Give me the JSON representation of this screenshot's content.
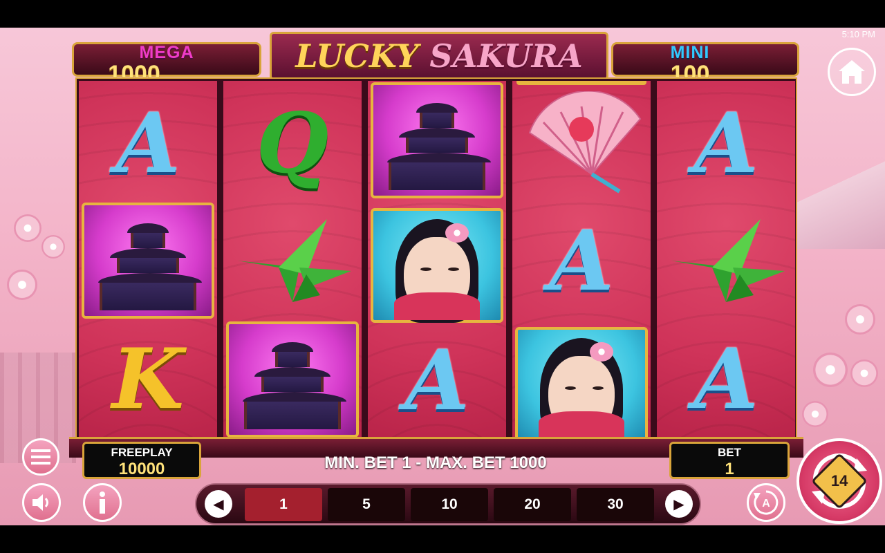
{
  "status": {
    "time": "5:10 PM"
  },
  "jackpots": {
    "mega": {
      "label": "MEGA",
      "value": "1000"
    },
    "mini": {
      "label": "MINI",
      "value": "100"
    }
  },
  "title": {
    "word1": "LUCKY",
    "word2": "SAKURA"
  },
  "reels": [
    [
      "A",
      "pagoda",
      "K"
    ],
    [
      "Q",
      "crane",
      "pagoda"
    ],
    [
      "pagoda",
      "geisha",
      "A"
    ],
    [
      "fan",
      "A",
      "geisha"
    ],
    [
      "A",
      "crane",
      "A"
    ]
  ],
  "symbols": {
    "a": "A",
    "q": "Q",
    "k": "K"
  },
  "freeplay": {
    "label": "FREEPLAY",
    "value": "10000"
  },
  "bet": {
    "label": "BET",
    "value": "1"
  },
  "limits_text": "MIN. BET 1 - MAX. BET 1000",
  "bet_options": [
    "1",
    "5",
    "10",
    "20",
    "30"
  ],
  "selected_bet": "1",
  "spin_badge": "14",
  "icons": {
    "home": "home-icon",
    "menu": "hamburger-menu-icon",
    "sound": "speaker-icon",
    "info": "info-icon",
    "autoplay": "autoplay-icon",
    "prev": "chevron-left-icon",
    "next": "chevron-right-icon",
    "spin": "spin-icon"
  }
}
